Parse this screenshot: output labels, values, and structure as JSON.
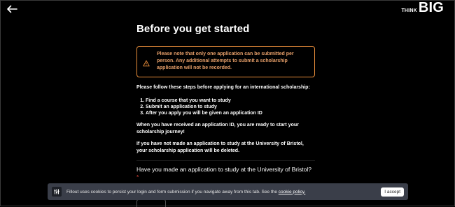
{
  "brand": {
    "small": "THINK",
    "big": "BIG"
  },
  "page": {
    "title": "Before you get started"
  },
  "notice": {
    "text": "Please note that only one application can be submitted per person. Any additional attempts to submit a scholarship application will not be recorded.",
    "color": "#e88d3a"
  },
  "instructions": {
    "intro": "Please follow these steps before applying for an international scholarship:",
    "steps": [
      "Find a course that you want to study",
      "Submit an application to study",
      "After you apply you will be given an application ID"
    ],
    "ready_text": "When you have received an application ID, you are ready to start your scholarship journey!",
    "warning_text": "If you have not made an application to study at the University of Bristol, your scholarship application will be deleted."
  },
  "question": {
    "label": "Have you made an application to study at the University of Bristol?",
    "required_mark": "*",
    "selected_value": ""
  },
  "cookie_bar": {
    "text": "Fillout uses cookies to persist your login and form submission if you navigate away from this tab. See the",
    "link_text": "cookie policy.",
    "accept_label": "I accept"
  }
}
